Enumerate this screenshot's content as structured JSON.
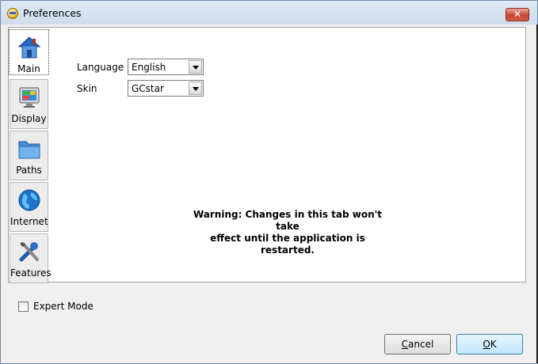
{
  "window": {
    "title": "Preferences",
    "close_symbol": "✕"
  },
  "tabs": [
    {
      "label": "Main",
      "icon": "house-icon",
      "active": true
    },
    {
      "label": "Display",
      "icon": "monitor-icon",
      "active": false
    },
    {
      "label": "Paths",
      "icon": "folder-icon",
      "active": false
    },
    {
      "label": "Internet",
      "icon": "globe-icon",
      "active": false
    },
    {
      "label": "Features",
      "icon": "tools-icon",
      "active": false
    }
  ],
  "main": {
    "language": {
      "label": "Language",
      "value": "English"
    },
    "skin": {
      "label": "Skin",
      "value": "GCstar"
    },
    "warning_line1": "Warning: Changes in this tab won't take",
    "warning_line2": "effect until the application is restarted."
  },
  "footer": {
    "expert_mode": {
      "label": "Expert Mode",
      "checked": false
    },
    "cancel": {
      "underlined": "C",
      "rest": "ancel"
    },
    "ok": {
      "underlined": "O",
      "rest": "K"
    }
  }
}
